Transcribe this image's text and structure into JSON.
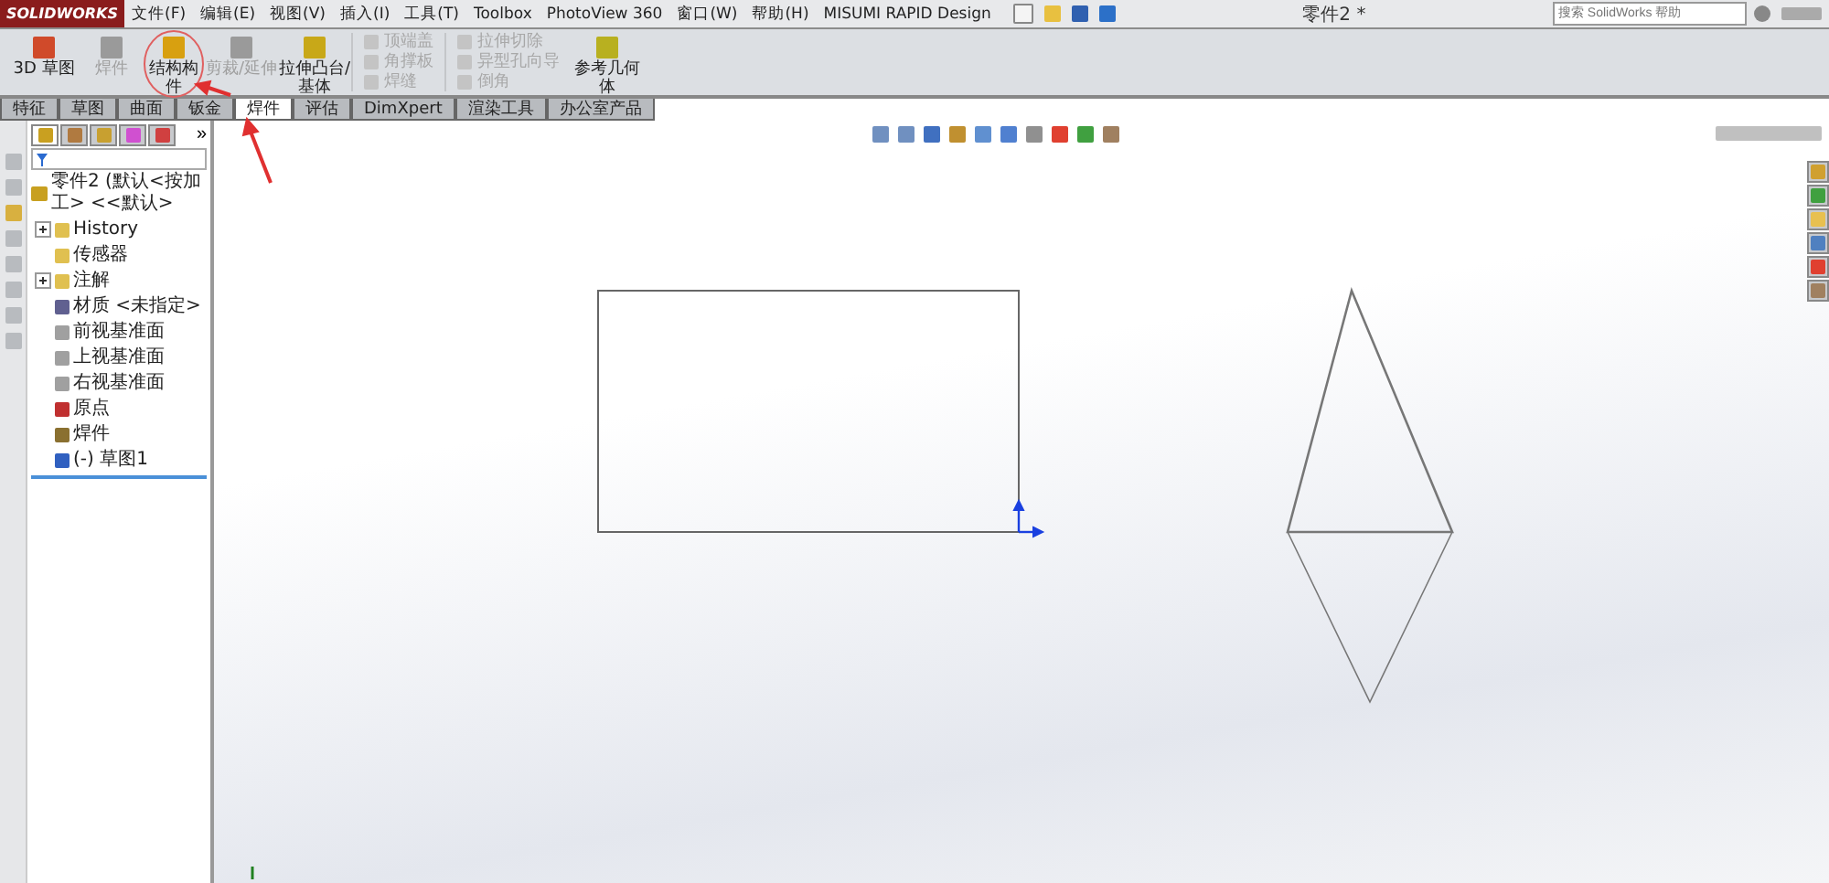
{
  "app": {
    "logo": "SOLIDWORKS"
  },
  "menu": [
    "文件(F)",
    "编辑(E)",
    "视图(V)",
    "插入(I)",
    "工具(T)",
    "Toolbox",
    "PhotoView 360",
    "窗口(W)",
    "帮助(H)",
    "MISUMI RAPID Design"
  ],
  "window": {
    "title": "零件2 *"
  },
  "search": {
    "placeholder": "搜索 SolidWorks 帮助"
  },
  "ribbon": [
    {
      "kind": "big",
      "label": "3D 草图",
      "disabled": false,
      "color": "#d04a2a"
    },
    {
      "kind": "big",
      "label": "焊件",
      "disabled": true,
      "color": "#9a9a9a"
    },
    {
      "kind": "big",
      "label": "结构构件",
      "disabled": false,
      "color": "#d8a010"
    },
    {
      "kind": "big",
      "label": "剪裁/延伸",
      "disabled": true,
      "color": "#9a9a9a"
    },
    {
      "kind": "big",
      "label": "拉伸凸台/基体",
      "disabled": false,
      "color": "#c8a818"
    },
    {
      "kind": "column",
      "items": [
        {
          "label": "顶端盖",
          "disabled": true
        },
        {
          "label": "角撑板",
          "disabled": true
        },
        {
          "label": "焊缝",
          "disabled": true
        }
      ]
    },
    {
      "kind": "column",
      "items": [
        {
          "label": "拉伸切除",
          "disabled": true
        },
        {
          "label": "异型孔向导",
          "disabled": true
        },
        {
          "label": "倒角",
          "disabled": true
        }
      ]
    },
    {
      "kind": "big",
      "label": "参考几何体",
      "disabled": false,
      "color": "#b8b020"
    }
  ],
  "tabs": [
    {
      "label": "特征",
      "selected": false
    },
    {
      "label": "草图",
      "selected": false
    },
    {
      "label": "曲面",
      "selected": false
    },
    {
      "label": "钣金",
      "selected": false
    },
    {
      "label": "焊件",
      "selected": true
    },
    {
      "label": "评估",
      "selected": false
    },
    {
      "label": "DimXpert",
      "selected": false
    },
    {
      "label": "渲染工具",
      "selected": false
    },
    {
      "label": "办公室产品",
      "selected": false
    }
  ],
  "panel_tabs": [
    {
      "selected": true
    },
    {
      "selected": false
    },
    {
      "selected": false
    },
    {
      "selected": false
    },
    {
      "selected": false
    }
  ],
  "panel_more": "»",
  "tree": {
    "label": "零件2 (默认<按加工> <<默认>",
    "children": [
      {
        "label": "History",
        "expanded": false
      },
      {
        "label": "传感器"
      },
      {
        "label": "注解",
        "expanded": false
      },
      {
        "label": "材质 <未指定>"
      },
      {
        "label": "前视基准面"
      },
      {
        "label": "上视基准面"
      },
      {
        "label": "右视基准面"
      },
      {
        "label": "原点"
      },
      {
        "label": "焊件"
      },
      {
        "label": "(-) 草图1"
      }
    ]
  }
}
